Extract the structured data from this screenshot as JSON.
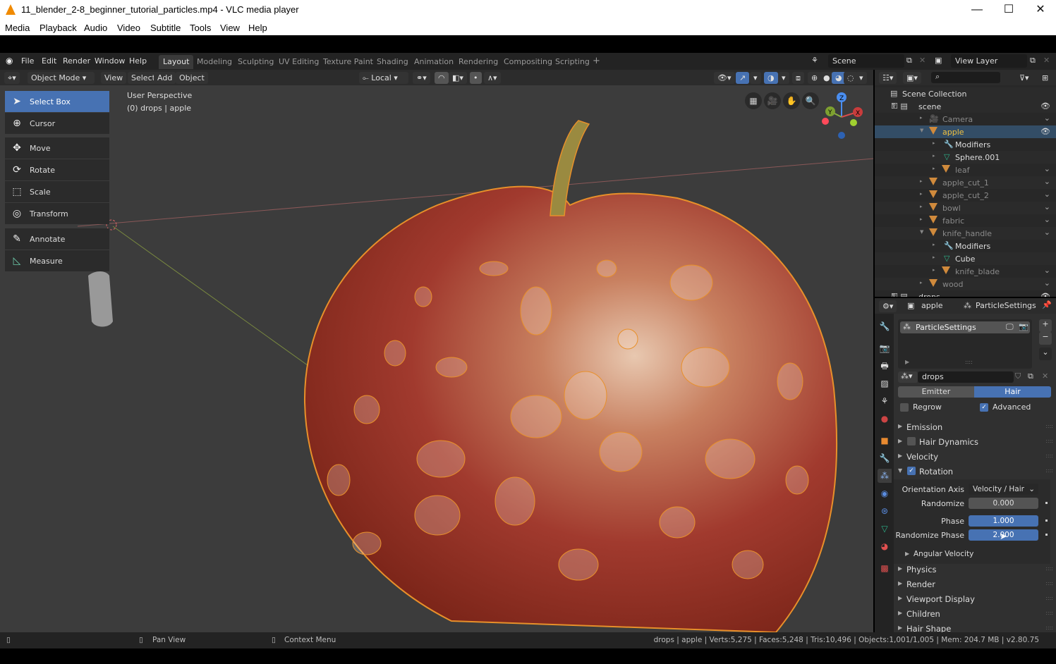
{
  "window": {
    "title": "11_blender_2-8_beginner_tutorial_particles.mp4 - VLC media player",
    "minimize": "—",
    "maximize": "☐",
    "close": "✕"
  },
  "vlc_menu": [
    "Media",
    "Playback",
    "Audio",
    "Video",
    "Subtitle",
    "Tools",
    "View",
    "Help"
  ],
  "blender": {
    "top_menu": [
      "File",
      "Edit",
      "Render",
      "Window",
      "Help"
    ],
    "workspaces": [
      "Layout",
      "Modeling",
      "Sculpting",
      "UV Editing",
      "Texture Paint",
      "Shading",
      "Animation",
      "Rendering",
      "Compositing",
      "Scripting"
    ],
    "active_workspace": "Layout",
    "add_workspace": "+",
    "scene": "Scene",
    "view_layer": "View Layer",
    "viewport_header": {
      "mode": "Object Mode",
      "menus": [
        "View",
        "Select",
        "Add",
        "Object"
      ],
      "transform_orientation": "Local"
    },
    "viewport": {
      "perspective": "User Perspective",
      "context": "(0) drops | apple",
      "gizmo": {
        "z": "Z",
        "y": "Y",
        "x": "X"
      }
    },
    "tools": [
      {
        "label": "Select Box",
        "icon": "select-box-icon",
        "glyph": "➤",
        "active": true
      },
      {
        "label": "Cursor",
        "icon": "cursor-icon",
        "glyph": "⊕",
        "active": false
      },
      {
        "label": "Move",
        "icon": "move-icon",
        "glyph": "✥",
        "active": false
      },
      {
        "label": "Rotate",
        "icon": "rotate-icon",
        "glyph": "⟳",
        "active": false
      },
      {
        "label": "Scale",
        "icon": "scale-icon",
        "glyph": "⬚",
        "active": false
      },
      {
        "label": "Transform",
        "icon": "transform-icon",
        "glyph": "◎",
        "active": false
      },
      {
        "label": "Annotate",
        "icon": "annotate-icon",
        "glyph": "✎",
        "active": false
      },
      {
        "label": "Measure",
        "icon": "measure-icon",
        "glyph": "📐",
        "active": false
      }
    ],
    "outliner": {
      "root": "Scene Collection",
      "rows": [
        {
          "name": "scene",
          "indent": 0,
          "kind": "collection",
          "vis": "eye"
        },
        {
          "name": "Camera",
          "indent": 1,
          "kind": "camera",
          "vis": "chev",
          "dim": true
        },
        {
          "name": "apple",
          "indent": 1,
          "kind": "mesh",
          "vis": "eye",
          "selected": true
        },
        {
          "name": "Modifiers",
          "indent": 2,
          "kind": "modifier",
          "vis": ""
        },
        {
          "name": "Sphere.001",
          "indent": 2,
          "kind": "meshdata",
          "vis": ""
        },
        {
          "name": "leaf",
          "indent": 2,
          "kind": "mesh",
          "vis": "chev",
          "dim": true
        },
        {
          "name": "apple_cut_1",
          "indent": 1,
          "kind": "mesh",
          "vis": "chev",
          "dim": true
        },
        {
          "name": "apple_cut_2",
          "indent": 1,
          "kind": "mesh",
          "vis": "chev",
          "dim": true
        },
        {
          "name": "bowl",
          "indent": 1,
          "kind": "mesh",
          "vis": "chev",
          "dim": true
        },
        {
          "name": "fabric",
          "indent": 1,
          "kind": "mesh",
          "vis": "chev",
          "dim": true
        },
        {
          "name": "knife_handle",
          "indent": 1,
          "kind": "mesh",
          "vis": "chev",
          "dim": true
        },
        {
          "name": "Modifiers",
          "indent": 2,
          "kind": "modifier",
          "vis": ""
        },
        {
          "name": "Cube",
          "indent": 2,
          "kind": "meshdata",
          "vis": ""
        },
        {
          "name": "knife_blade",
          "indent": 2,
          "kind": "mesh",
          "vis": "chev",
          "dim": true
        },
        {
          "name": "wood",
          "indent": 1,
          "kind": "mesh",
          "vis": "chev",
          "dim": true
        },
        {
          "name": "drops",
          "indent": 0,
          "kind": "collection",
          "vis": "eye"
        }
      ]
    },
    "properties": {
      "breadcrumb_object": "apple",
      "breadcrumb_data": "ParticleSettings",
      "slot_name": "ParticleSettings",
      "settings_name": "drops",
      "type_options": [
        "Emitter",
        "Hair"
      ],
      "type_selected": "Hair",
      "regrow_label": "Regrow",
      "regrow_checked": false,
      "advanced_label": "Advanced",
      "advanced_checked": true,
      "panels": {
        "emission": "Emission",
        "hair_dynamics": "Hair Dynamics",
        "velocity": "Velocity",
        "rotation": "Rotation",
        "angular_velocity": "Angular Velocity",
        "physics": "Physics",
        "render": "Render",
        "viewport_display": "Viewport Display",
        "children": "Children",
        "hair_shape": "Hair Shape"
      },
      "rotation": {
        "orientation_axis_label": "Orientation Axis",
        "orientation_axis": "Velocity / Hair",
        "randomize_label": "Randomize",
        "randomize": "0.000",
        "phase_label": "Phase",
        "phase": "1.000",
        "randomize_phase_label": "Randomize Phase",
        "randomize_phase": "2.000"
      }
    },
    "statusbar": {
      "pan": "Pan View",
      "context": "Context Menu",
      "stats": "drops | apple | Verts:5,275 | Faces:5,248 | Tris:10,496 | Objects:1,001/1,005 | Mem: 204.7 MB | v2.80.75"
    }
  },
  "colors": {
    "accent": "#4772b3",
    "selected_row": "#334d66",
    "viewport_bg": "#3c3c3c",
    "apple_red": "#a8403a",
    "outline": "#e8902a"
  }
}
